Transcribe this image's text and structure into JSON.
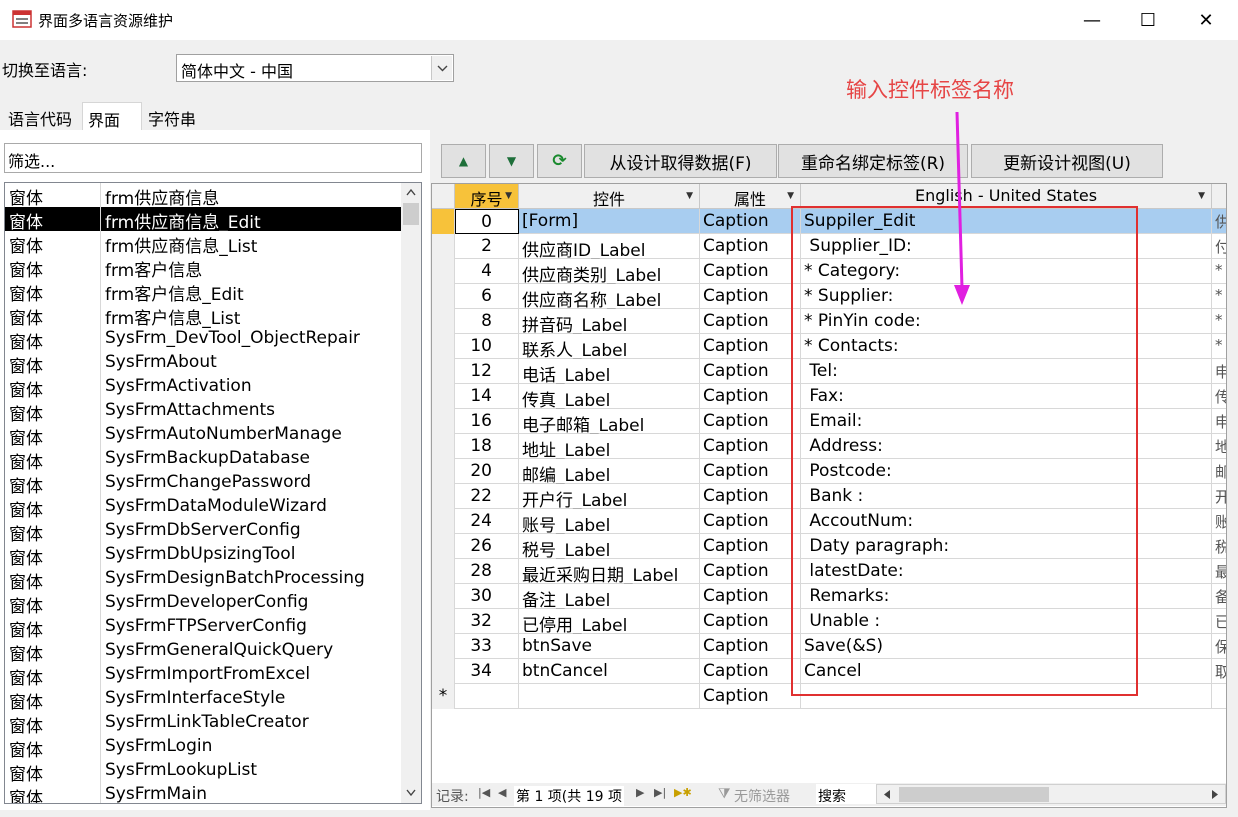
{
  "window": {
    "title": "界面多语言资源维护",
    "minimize_glyph": "—",
    "maximize_glyph": "☐",
    "close_glyph": "✕"
  },
  "toolbar": {
    "switch_label": "切换至语言:",
    "language_value": "简体中文 - 中国"
  },
  "annotation": "输入控件标签名称",
  "tabs": [
    "语言代码",
    "界面",
    "字符串"
  ],
  "filter": {
    "value": "筛选..."
  },
  "list_items": [
    {
      "type": "窗体",
      "name": "frm供应商信息"
    },
    {
      "type": "窗体",
      "name": "frm供应商信息_Edit"
    },
    {
      "type": "窗体",
      "name": "frm供应商信息_List"
    },
    {
      "type": "窗体",
      "name": "frm客户信息"
    },
    {
      "type": "窗体",
      "name": "frm客户信息_Edit"
    },
    {
      "type": "窗体",
      "name": "frm客户信息_List"
    },
    {
      "type": "窗体",
      "name": "SysFrm_DevTool_ObjectRepair"
    },
    {
      "type": "窗体",
      "name": "SysFrmAbout"
    },
    {
      "type": "窗体",
      "name": "SysFrmActivation"
    },
    {
      "type": "窗体",
      "name": "SysFrmAttachments"
    },
    {
      "type": "窗体",
      "name": "SysFrmAutoNumberManage"
    },
    {
      "type": "窗体",
      "name": "SysFrmBackupDatabase"
    },
    {
      "type": "窗体",
      "name": "SysFrmChangePassword"
    },
    {
      "type": "窗体",
      "name": "SysFrmDataModuleWizard"
    },
    {
      "type": "窗体",
      "name": "SysFrmDbServerConfig"
    },
    {
      "type": "窗体",
      "name": "SysFrmDbUpsizingTool"
    },
    {
      "type": "窗体",
      "name": "SysFrmDesignBatchProcessing"
    },
    {
      "type": "窗体",
      "name": "SysFrmDeveloperConfig"
    },
    {
      "type": "窗体",
      "name": "SysFrmFTPServerConfig"
    },
    {
      "type": "窗体",
      "name": "SysFrmGeneralQuickQuery"
    },
    {
      "type": "窗体",
      "name": "SysFrmImportFromExcel"
    },
    {
      "type": "窗体",
      "name": "SysFrmInterfaceStyle"
    },
    {
      "type": "窗体",
      "name": "SysFrmLinkTableCreator"
    },
    {
      "type": "窗体",
      "name": "SysFrmLogin"
    },
    {
      "type": "窗体",
      "name": "SysFrmLookupList"
    },
    {
      "type": "窗体",
      "name": "SysFrmMain"
    }
  ],
  "selected_list_index": 1,
  "buttons": {
    "up": "▲",
    "down": "▼",
    "refresh": "⟳",
    "fetch": "从设计取得数据(F)",
    "rename": "重命名绑定标签(R)",
    "update": "更新设计视图(U)"
  },
  "grid": {
    "headers": {
      "seq": "序号",
      "control": "控件",
      "attribute": "属性",
      "english": "English - United States"
    },
    "rows": [
      {
        "seq": "0",
        "control": "[Form]",
        "attribute": "Caption",
        "english": "Suppiler_Edit",
        "extra": "供"
      },
      {
        "seq": "2",
        "control": "供应商ID_Label",
        "attribute": "Caption",
        "english": " Supplier_ID:",
        "extra": "付"
      },
      {
        "seq": "4",
        "control": "供应商类别_Label",
        "attribute": "Caption",
        "english": "* Category:",
        "extra": "*"
      },
      {
        "seq": "6",
        "control": "供应商名称_Label",
        "attribute": "Caption",
        "english": "* Supplier:",
        "extra": "*"
      },
      {
        "seq": "8",
        "control": "拼音码_Label",
        "attribute": "Caption",
        "english": "* PinYin code:",
        "extra": "*"
      },
      {
        "seq": "10",
        "control": "联系人_Label",
        "attribute": "Caption",
        "english": "* Contacts:",
        "extra": "*"
      },
      {
        "seq": "12",
        "control": "电话_Label",
        "attribute": "Caption",
        "english": " Tel:",
        "extra": "申"
      },
      {
        "seq": "14",
        "control": "传真_Label",
        "attribute": "Caption",
        "english": " Fax:",
        "extra": "传"
      },
      {
        "seq": "16",
        "control": "电子邮箱_Label",
        "attribute": "Caption",
        "english": " Email:",
        "extra": "申"
      },
      {
        "seq": "18",
        "control": "地址_Label",
        "attribute": "Caption",
        "english": " Address:",
        "extra": "地"
      },
      {
        "seq": "20",
        "control": "邮编_Label",
        "attribute": "Caption",
        "english": " Postcode:",
        "extra": "邮"
      },
      {
        "seq": "22",
        "control": "开户行_Label",
        "attribute": "Caption",
        "english": " Bank :",
        "extra": "开"
      },
      {
        "seq": "24",
        "control": "账号_Label",
        "attribute": "Caption",
        "english": " AccoutNum:",
        "extra": "账"
      },
      {
        "seq": "26",
        "control": "税号_Label",
        "attribute": "Caption",
        "english": " Daty paragraph:",
        "extra": "税"
      },
      {
        "seq": "28",
        "control": "最近采购日期_Label",
        "attribute": "Caption",
        "english": " latestDate:",
        "extra": "最"
      },
      {
        "seq": "30",
        "control": "备注_Label",
        "attribute": "Caption",
        "english": " Remarks:",
        "extra": "备"
      },
      {
        "seq": "32",
        "control": "已停用_Label",
        "attribute": "Caption",
        "english": " Unable :",
        "extra": "已"
      },
      {
        "seq": "33",
        "control": "btnSave",
        "attribute": "Caption",
        "english": "Save(&S)",
        "extra": "保"
      },
      {
        "seq": "34",
        "control": "btnCancel",
        "attribute": "Caption",
        "english": "Cancel",
        "extra": "取"
      }
    ],
    "new_row": {
      "marker": "*",
      "attribute": "Caption"
    }
  },
  "status": {
    "record_label": "记录:",
    "position": "第 1 项(共 19 项",
    "filter": "无筛选器",
    "search": "搜索"
  },
  "colors": {
    "annotation": "#e64545",
    "highlight_box": "#e03030",
    "arrow": "#e020e0",
    "current_row": "#a8cdf0"
  }
}
